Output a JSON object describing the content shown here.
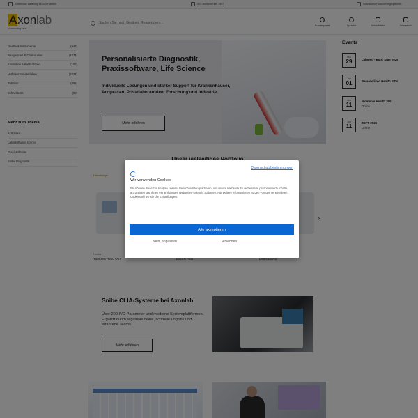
{
  "topbar": {
    "items": [
      {
        "icon": "truck-icon",
        "text": "Kostenlose Lieferung ab 300 Franken"
      },
      {
        "icon": "certificate-icon",
        "text": "ISO zertifiziert seit 1997"
      },
      {
        "icon": "return-icon",
        "text": "Individuelle Finanzierungsoptionen"
      }
    ]
  },
  "header": {
    "logo": {
      "a": "A",
      "xon": "xon",
      "lab": "lab",
      "tagline": "connecting labs"
    },
    "search": {
      "placeholder": "Suchen Sie nach Geräten, Reagenzien ..."
    },
    "nav": [
      {
        "icon": "user-icon",
        "label": "Kundenportal"
      },
      {
        "icon": "globe-icon",
        "label": "Sprache"
      },
      {
        "icon": "document-icon",
        "label": "Einkaufsliste"
      },
      {
        "icon": "cart-icon",
        "label": "Warenkorb"
      }
    ]
  },
  "sidebar": {
    "categories": [
      {
        "label": "Geräte & Instrumente",
        "count": "(943)"
      },
      {
        "label": "Reagenzien & Chemikalien",
        "count": "(4274)"
      },
      {
        "label": "Kontrollen & Kalibratoren",
        "count": "(162)"
      },
      {
        "label": "Verbrauchsmaterialien",
        "count": "(2427)"
      },
      {
        "label": "Zubehör",
        "count": "(895)"
      },
      {
        "label": "Schnelltests",
        "count": "(89)"
      }
    ],
    "theme_heading": "Mehr zum Thema",
    "themes": [
      "Arztpraxis",
      "Laborsoftware skonio",
      "Praxissoftware",
      "Snibe Diagnostik"
    ]
  },
  "hero": {
    "title": "Personalisierte Diagnostik, Praxissoftware, Life Science",
    "text": "Individuelle Lösungen und starker Support für Krankenhäuser, Arztpraxen, Privatlaboratorien, Forschung und Industrie.",
    "button": "Mehr erfahren"
  },
  "events": {
    "heading": "Events",
    "items": [
      {
        "month": "Mai",
        "day": "29",
        "title": "Labmed - BMA Tage 2026",
        "sub": ""
      },
      {
        "month": "Jun",
        "day": "01",
        "title": "Personalized Health ETH",
        "sub": ""
      },
      {
        "month": "Jun",
        "day": "11",
        "title": "Women's Health 360",
        "sub": "Online"
      },
      {
        "month": "Jun",
        "day": "11",
        "title": "ZDFT 2026",
        "sub": "Online"
      }
    ]
  },
  "portfolio": {
    "title": "Unser vielseitiges Portfolio",
    "products": [
      {
        "category": "Hämatologie",
        "brand": "Horiba",
        "name": "Yumizen H500 OTF"
      },
      {
        "category": "",
        "brand": "",
        "name": "Bact/R Plus"
      },
      {
        "category": "",
        "brand": "",
        "name": "DetectionAX"
      }
    ]
  },
  "snibe": {
    "title": "Snibe CLIA-Systeme bei Axonlab",
    "text": "Über 200 IVD-Parameter und moderne Systemplattformen. Ergänzt durch regionale Nähe, schnelle Logistik und erfahrene Teams.",
    "button": "Mehr erfahren"
  },
  "cookie": {
    "policy_link": "Datenschutzbestimmungen",
    "title": "Wir verwenden Cookies",
    "body": "Wir können diese zur Analyse unserer Besucherdaten platzieren, um unsere Webseite zu verbessern, personalisierte Inhalte anzuzeigen und Ihnen ein großartiges Webseiten-Erlebnis zu bieten. Für weitere Informationen zu den von uns verwendeten Cookies öffnen Sie die Einstellungen.",
    "accept": "Alle akzeptieren",
    "customize": "Nein, anpassen",
    "decline": "Ablehnen",
    "accent": "#0a66d2"
  }
}
